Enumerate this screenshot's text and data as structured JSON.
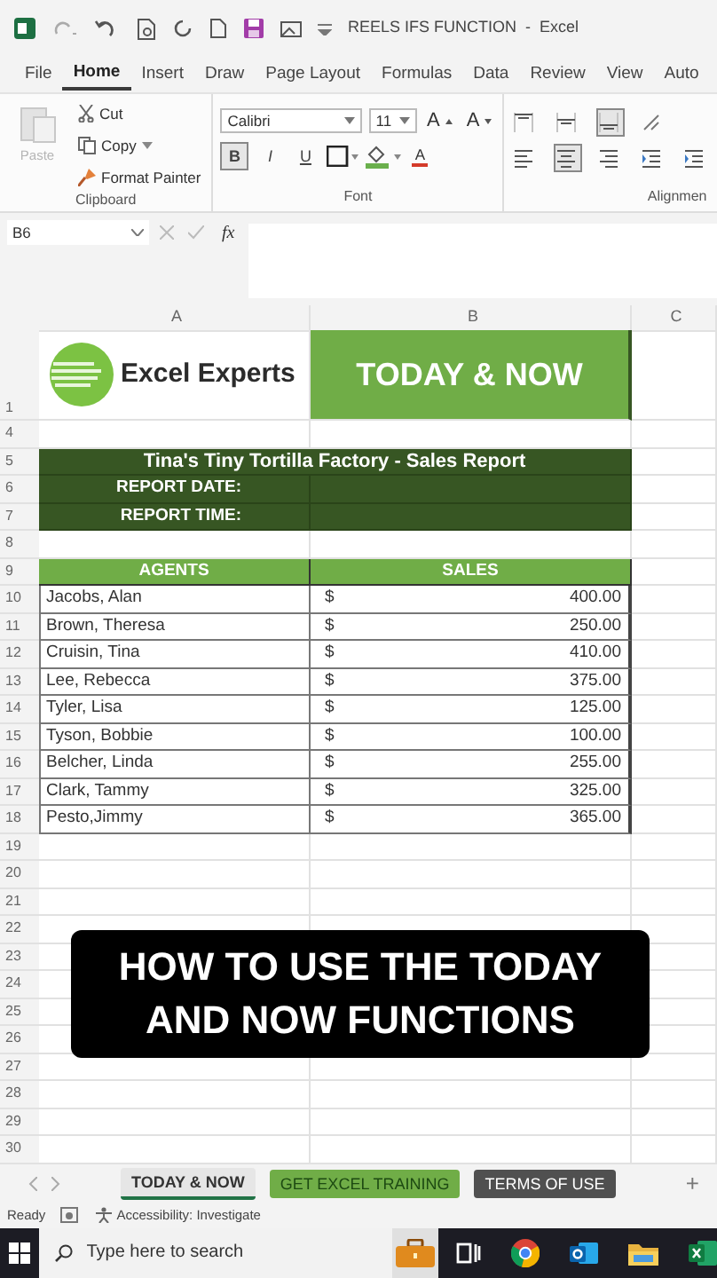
{
  "window": {
    "title": "REELS IFS FUNCTION  -  Excel"
  },
  "ribbon_tabs": [
    {
      "label": "File",
      "selected": false
    },
    {
      "label": "Home",
      "selected": true
    },
    {
      "label": "Insert",
      "selected": false
    },
    {
      "label": "Draw",
      "selected": false
    },
    {
      "label": "Page Layout",
      "selected": false
    },
    {
      "label": "Formulas",
      "selected": false
    },
    {
      "label": "Data",
      "selected": false
    },
    {
      "label": "Review",
      "selected": false
    },
    {
      "label": "View",
      "selected": false
    },
    {
      "label": "Auto",
      "selected": false
    }
  ],
  "ribbon": {
    "clipboard": {
      "label": "Clipboard",
      "paste": {
        "label": "Paste",
        "disabled": true
      },
      "cut": "Cut",
      "copy": "Copy",
      "format_painter": "Format Painter"
    },
    "font": {
      "label": "Font",
      "font_name": "Calibri",
      "font_size": "11",
      "size_buttons": [
        "A",
        "A"
      ],
      "styles": [
        {
          "label": "B",
          "selected": true
        },
        {
          "label": "I",
          "selected": false
        },
        {
          "label": "U",
          "selected": false
        }
      ],
      "font_color_label": "A"
    },
    "alignment": {
      "label": "Alignmen",
      "buttons": [
        {
          "kind": "top",
          "selected": false
        },
        {
          "kind": "middle",
          "selected": false
        },
        {
          "kind": "bottom",
          "selected": true
        },
        {
          "kind": "orientation",
          "selected": false
        },
        {
          "kind": "left",
          "selected": false
        },
        {
          "kind": "center",
          "selected": true
        },
        {
          "kind": "right",
          "selected": false
        },
        {
          "kind": "outdent",
          "selected": false
        },
        {
          "kind": "indent",
          "selected": false
        }
      ]
    }
  },
  "formula_bar": {
    "name_box": "B6",
    "fx": "fx"
  },
  "sheet": {
    "columns": [
      "A",
      "B",
      "C"
    ],
    "rows": [
      {
        "number": "1",
        "kind": "banner",
        "logo_text": "Excel Experts",
        "title": "TODAY & NOW"
      },
      {
        "number": "4",
        "kind": "blank"
      },
      {
        "number": "5",
        "kind": "report_title",
        "text": "Tina's Tiny Tortilla Factory - Sales Report"
      },
      {
        "number": "6",
        "kind": "report_field",
        "label": "REPORT DATE:"
      },
      {
        "number": "7",
        "kind": "report_field",
        "label": "REPORT TIME:"
      },
      {
        "number": "8",
        "kind": "blank"
      },
      {
        "number": "9",
        "kind": "table_header",
        "cells": [
          "AGENTS",
          "SALES"
        ]
      },
      {
        "number": "10",
        "kind": "data",
        "agent": "Jacobs, Alan",
        "currency": "$",
        "amount": "400.00"
      },
      {
        "number": "11",
        "kind": "data",
        "agent": "Brown, Theresa",
        "currency": "$",
        "amount": "250.00"
      },
      {
        "number": "12",
        "kind": "data",
        "agent": "Cruisin, Tina",
        "currency": "$",
        "amount": "410.00"
      },
      {
        "number": "13",
        "kind": "data",
        "agent": "Lee, Rebecca",
        "currency": "$",
        "amount": "375.00"
      },
      {
        "number": "14",
        "kind": "data",
        "agent": "Tyler, Lisa",
        "currency": "$",
        "amount": "125.00"
      },
      {
        "number": "15",
        "kind": "data",
        "agent": "Tyson, Bobbie",
        "currency": "$",
        "amount": "100.00"
      },
      {
        "number": "16",
        "kind": "data",
        "agent": "Belcher, Linda",
        "currency": "$",
        "amount": "255.00"
      },
      {
        "number": "17",
        "kind": "data",
        "agent": "Clark, Tammy",
        "currency": "$",
        "amount": "325.00"
      },
      {
        "number": "18",
        "kind": "data",
        "agent": "Pesto,Jimmy",
        "currency": "$",
        "amount": "365.00"
      },
      {
        "number": "19",
        "kind": "blank"
      },
      {
        "number": "20",
        "kind": "blank"
      },
      {
        "number": "21",
        "kind": "blank"
      },
      {
        "number": "22",
        "kind": "blank"
      },
      {
        "number": "23",
        "kind": "blank"
      },
      {
        "number": "24",
        "kind": "blank"
      },
      {
        "number": "25",
        "kind": "blank"
      },
      {
        "number": "26",
        "kind": "blank"
      },
      {
        "number": "27",
        "kind": "blank"
      },
      {
        "number": "28",
        "kind": "blank"
      },
      {
        "number": "29",
        "kind": "blank"
      },
      {
        "number": "30",
        "kind": "blank"
      }
    ]
  },
  "caption": {
    "lines": [
      "HOW TO USE THE TODAY",
      "AND NOW FUNCTIONS"
    ]
  },
  "sheet_tabs": [
    {
      "label": "TODAY & NOW",
      "selected": true,
      "color": "#e6e6e6"
    },
    {
      "label": "GET EXCEL TRAINING",
      "selected": false,
      "color": "#70ad47"
    },
    {
      "label": "TERMS OF USE",
      "selected": false,
      "color": "#505050"
    }
  ],
  "add_sheet": "+",
  "status_bar": {
    "mode": "Ready",
    "accessibility": "Accessibility: Investigate"
  },
  "taskbar": {
    "search_placeholder": "Type here to search"
  }
}
